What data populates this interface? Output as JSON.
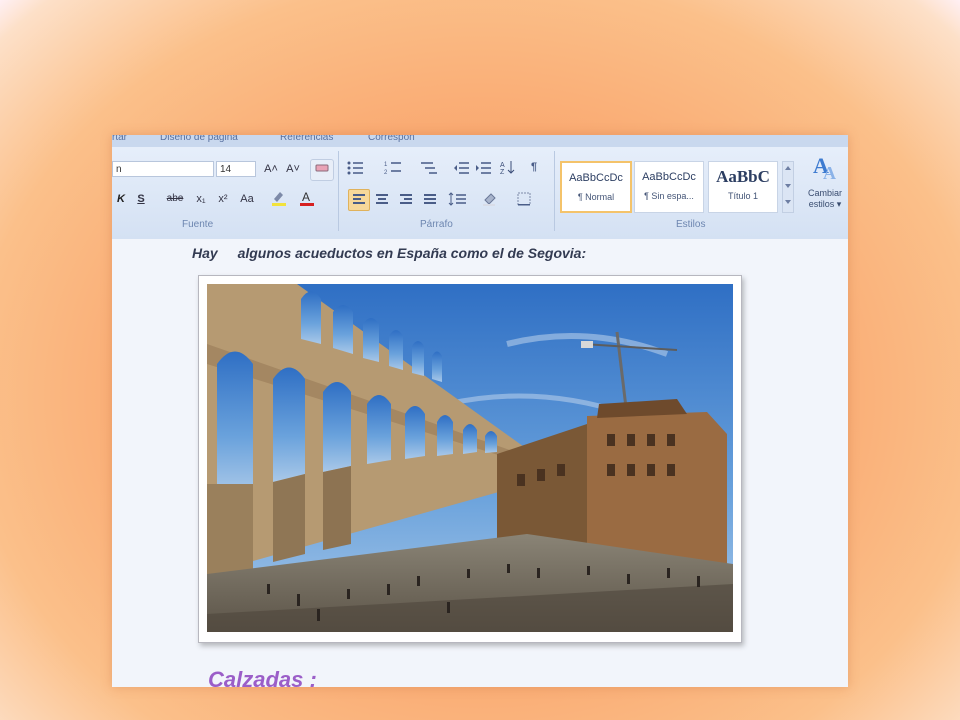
{
  "ribbon": {
    "tabs": [
      "rtar",
      "Diseño de página",
      "Referencias",
      "Correspon"
    ],
    "font_name": "n",
    "font_size": "14",
    "groups": {
      "fuente": "Fuente",
      "parrafo": "Párrafo",
      "estilos": "Estilos"
    },
    "styles": [
      {
        "sample": "AaBbCcDc",
        "name": "¶ Normal",
        "selected": true
      },
      {
        "sample": "AaBbCcDc",
        "name": "¶ Sin espa...",
        "selected": false
      },
      {
        "sample": "AaBbC",
        "name": "Título 1",
        "selected": false
      }
    ],
    "change_styles": {
      "line1": "Cambiar",
      "line2": "estilos ▾"
    },
    "font_buttons": {
      "grow": "A˄",
      "shrink": "A˅",
      "bold": "K",
      "underline": "S",
      "strike": "abe",
      "subscript": "x₁",
      "superscript": "x²",
      "case": "Aa"
    }
  },
  "document": {
    "line_hay": "Hay",
    "line_rest": "algunos acueductos en España como el de Segovia:",
    "heading": "Calzadas :"
  },
  "photo": {
    "description_icon": "segovia-aqueduct-photo"
  }
}
